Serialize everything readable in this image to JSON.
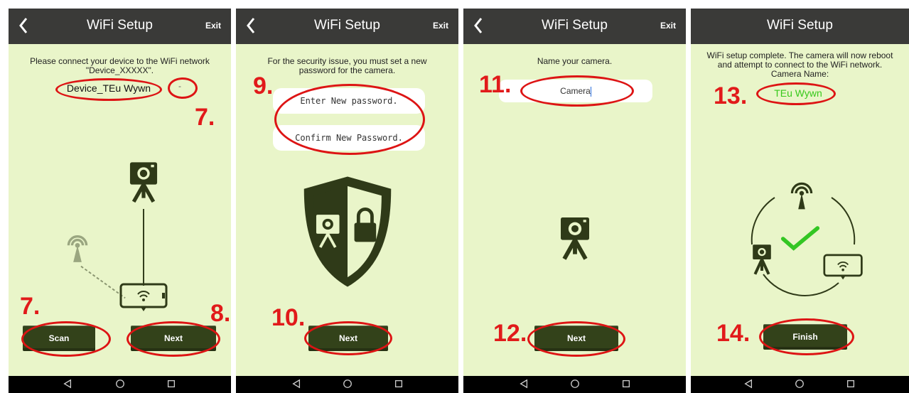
{
  "colors": {
    "screen_bg": "#e9f5c9",
    "appbar_bg": "#3a3a38",
    "button_bg": "#33421a",
    "annotation_red": "#e11a1a",
    "camera_name_green": "#36c91a",
    "check_green": "#33c623",
    "icon_dark": "#2f3a18"
  },
  "screen1": {
    "title": "WiFi Setup",
    "exit": "Exit",
    "message_line1": "Please connect your device to the WiFi network",
    "message_line2": "\"Device_XXXXX\".",
    "network_value": "Device_TEu  Wywn",
    "dropdown_value": "-",
    "scan_label": "Scan",
    "next_label": "Next",
    "annotation_top": "7.",
    "annotation_scan": "7.",
    "annotation_next": "8.",
    "icons": [
      "back-arrow-icon",
      "camera-tripod-icon",
      "router-icon",
      "phone-wifi-icon"
    ]
  },
  "screen2": {
    "title": "WiFi Setup",
    "exit": "Exit",
    "message_line1": "For the security issue, you must set a new",
    "message_line2": "password for the camera.",
    "new_password_placeholder": "Enter New password.",
    "confirm_password_placeholder": "Confirm New Password.",
    "next_label": "Next",
    "annotation_fields": "9.",
    "annotation_next": "10.",
    "icons": [
      "back-arrow-icon",
      "shield-camera-lock-icon"
    ]
  },
  "screen3": {
    "title": "WiFi Setup",
    "exit": "Exit",
    "message": "Name your camera.",
    "camera_name_value": "Camera",
    "next_label": "Next",
    "annotation_field": "11.",
    "annotation_next": "12.",
    "icons": [
      "back-arrow-icon",
      "camera-tripod-icon"
    ]
  },
  "screen4": {
    "title": "WiFi Setup",
    "message_line1": "WiFi setup complete. The camera will now reboot",
    "message_line2": "and attempt to connect to the WiFi network.",
    "camera_name_label": "Camera Name:",
    "camera_name_value": "TEu  Wywn",
    "finish_label": "Finish",
    "annotation_name": "13.",
    "annotation_finish": "14.",
    "icons": [
      "router-icon",
      "camera-tripod-icon",
      "phone-wifi-icon",
      "check-icon"
    ]
  },
  "navbar_icons": [
    "nav-back-icon",
    "nav-home-icon",
    "nav-recents-icon"
  ]
}
